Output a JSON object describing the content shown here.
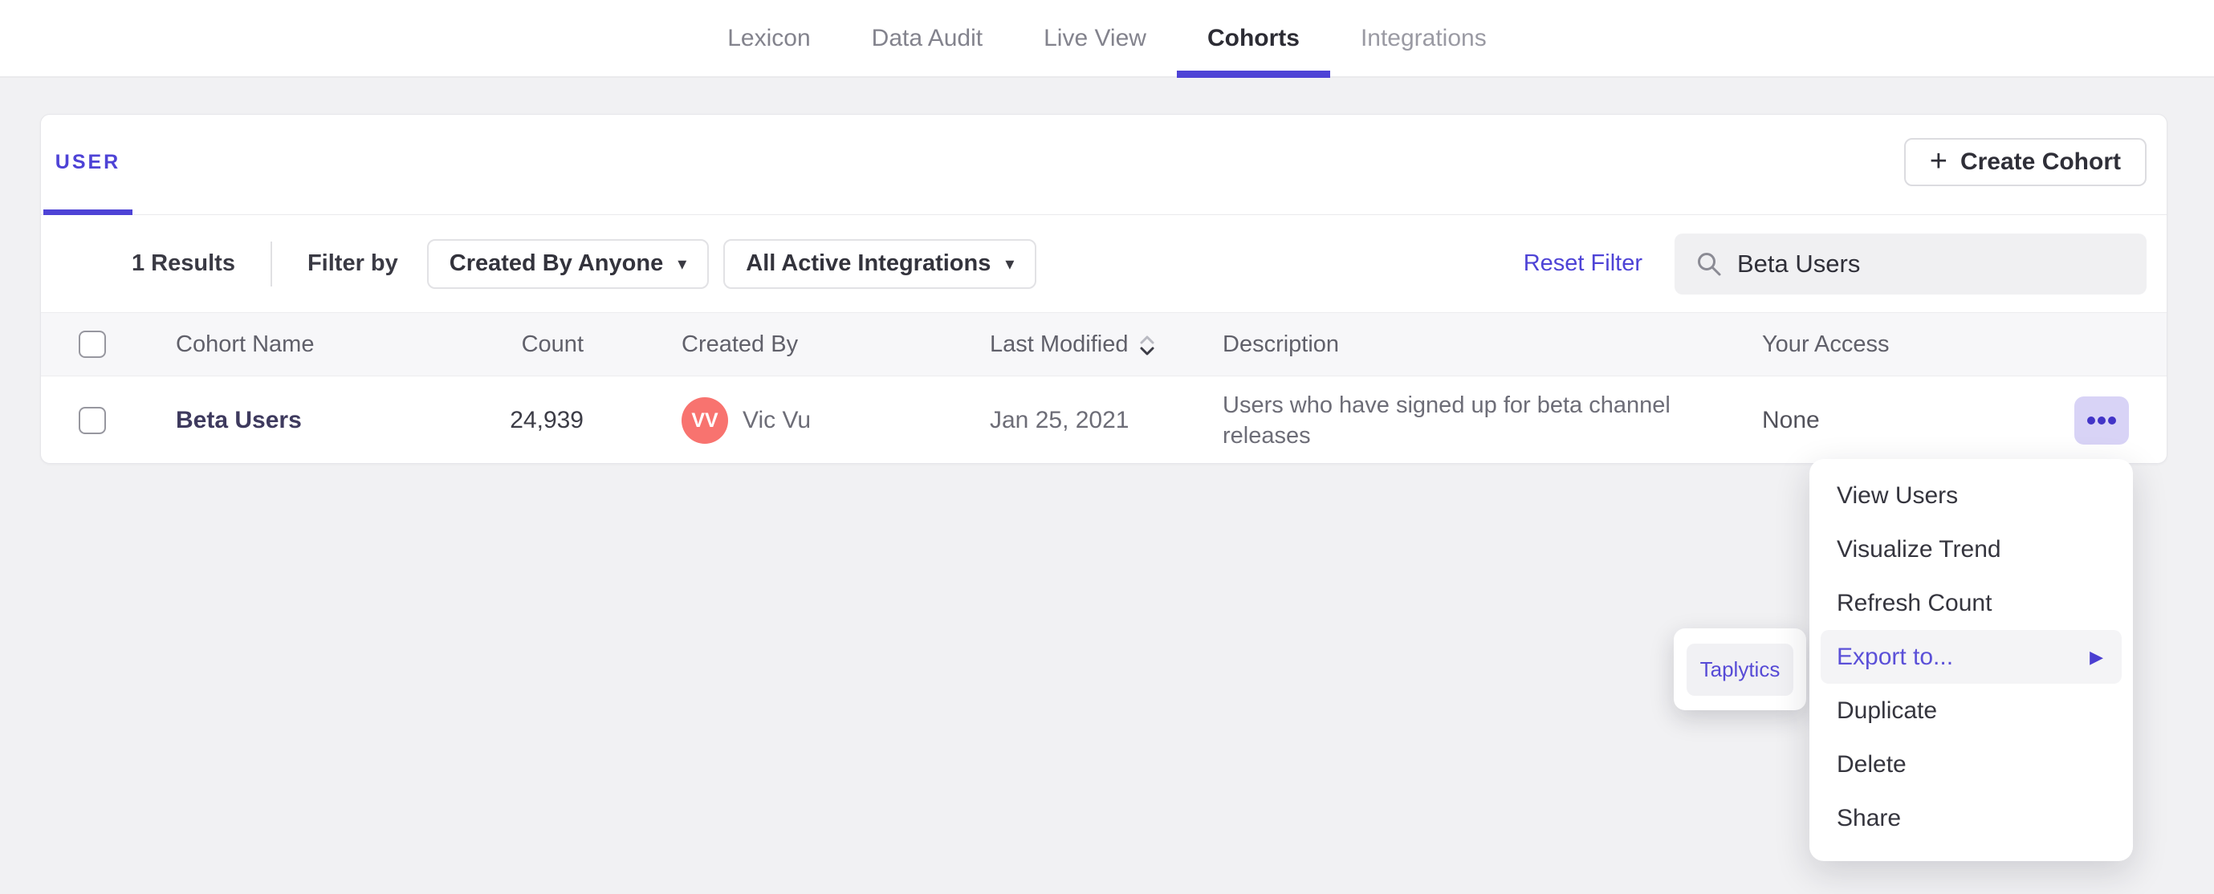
{
  "nav": {
    "items": [
      {
        "label": "Lexicon",
        "active": false
      },
      {
        "label": "Data Audit",
        "active": false
      },
      {
        "label": "Live View",
        "active": false
      },
      {
        "label": "Cohorts",
        "active": true
      },
      {
        "label": "Integrations",
        "active": false
      }
    ]
  },
  "card": {
    "tab_label": "USER",
    "create_label": "Create Cohort"
  },
  "filter": {
    "results": "1 Results",
    "filter_by": "Filter by",
    "created_by_dropdown": "Created By Anyone",
    "integrations_dropdown": "All Active Integrations",
    "reset": "Reset Filter",
    "search_value": "Beta Users"
  },
  "table": {
    "select_all_checked": false,
    "headers": {
      "cohort_name": "Cohort Name",
      "count": "Count",
      "created_by": "Created By",
      "last_modified": "Last Modified",
      "last_modified_sort": "descending",
      "description": "Description",
      "your_access": "Your Access"
    },
    "row": {
      "selected": false,
      "name": "Beta Users",
      "count": "24,939",
      "avatar_initials": "VV",
      "created_by": "Vic Vu",
      "last_modified": "Jan 25, 2021",
      "description": "Users who have signed up for beta channel releases",
      "your_access": "None"
    }
  },
  "menu": {
    "items": [
      {
        "label": "View Users",
        "highlighted": false
      },
      {
        "label": "Visualize Trend",
        "highlighted": false
      },
      {
        "label": "Refresh Count",
        "highlighted": false
      },
      {
        "label": "Export to...",
        "highlighted": true,
        "has_submenu": true
      },
      {
        "label": "Duplicate",
        "highlighted": false
      },
      {
        "label": "Delete",
        "highlighted": false
      },
      {
        "label": "Share",
        "highlighted": false
      }
    ]
  },
  "submenu": {
    "label": "Taplytics"
  },
  "icons": {
    "plus": "+",
    "caret": "▾",
    "submenu_arrow": "▶"
  },
  "colors": {
    "accent": "#4E43D6",
    "avatar": "#F8736F",
    "more_button_bg": "#D8D3F6",
    "more_button_icon": "#4234C7",
    "highlight_row_bg": "#F4F4F6",
    "page_bg": "#F1F1F3"
  }
}
